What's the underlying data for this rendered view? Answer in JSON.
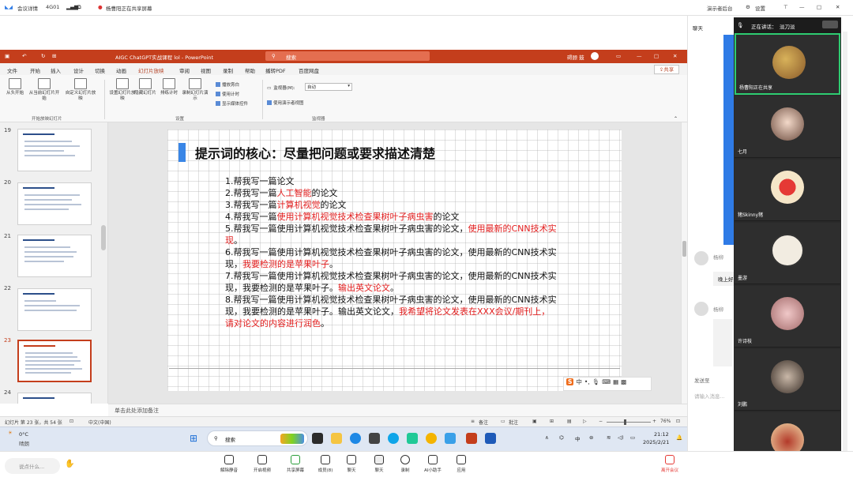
{
  "meeting": {
    "app_title": "会议详情",
    "network": "4G01",
    "meeting_name": "杨曹阳正在共享屏幕",
    "top_right": [
      "演示者后台",
      "设置"
    ],
    "speaker_label": "正在讲话：",
    "speaker_name": "淡刀淡"
  },
  "ppt": {
    "window_title": "AIGC ChatGPT实战课程 lol  -  PowerPoint",
    "search_placeholder": "搜索",
    "user": "碍顾 鼓",
    "tabs": [
      "文件",
      "开始",
      "插入",
      "设计",
      "切换",
      "动画",
      "幻灯片放映",
      "审阅",
      "视图",
      "录制",
      "帮助",
      "播转PDF",
      "百度网盘"
    ],
    "active_tab": "幻灯片放映",
    "share_label": "共享",
    "ribbon_buttons": [
      "从头开始",
      "从当前幻灯片开始",
      "自定义幻灯片放映",
      "设置幻灯片放映",
      "隐藏幻灯片",
      "排练计时",
      "录制幻灯片演示"
    ],
    "checks": [
      "播放旁白",
      "使用计时",
      "显示媒体控件"
    ],
    "monitor_label": "监视器(M):",
    "monitor_value": "自动",
    "presenter_view": "使用演示者视图",
    "groups": [
      "开始放映幻灯片",
      "设置",
      "监视器"
    ],
    "notes_placeholder": "单击此处添加备注",
    "status_left": "幻灯片 第 23 张，共 54 张",
    "status_lang": "中文(中国)",
    "status_notes": "备注",
    "status_comments": "批注",
    "zoom": "76%"
  },
  "slides": {
    "numbers": [
      "19",
      "20",
      "21",
      "22",
      "23",
      "24"
    ],
    "selected": "23"
  },
  "slide": {
    "title": "提示词的核心：尽量把问题或要求描述清楚",
    "items": [
      {
        "n": "1.帮我写一篇论文",
        "r": "",
        "t": ""
      },
      {
        "n": "2.帮我写一篇",
        "r": "人工智能",
        "t": "的论文"
      },
      {
        "n": "3.帮我写一篇",
        "r": "计算机视觉",
        "t": "的论文"
      },
      {
        "n": "4.帮我写一篇",
        "r": "使用计算机视觉技术检查果树叶子病虫害",
        "t": "的论文"
      },
      {
        "n": "5.帮我写一篇使用计算机视觉技术检查果树叶子病虫害的论文，",
        "r": "使用最新的CNN技术实现",
        "t": "。"
      },
      {
        "n": "6.帮我写一篇使用计算机视觉技术检查果树叶子病虫害的论文，使用最新的CNN技术实现，",
        "r": "我要检测的是苹果叶子",
        "t": "。"
      },
      {
        "n": "7.帮我写一篇使用计算机视觉技术检查果树叶子病虫害的论文，使用最新的CNN技术实现，我要检测的是苹果叶子。",
        "r": "输出英文论文",
        "t": "。"
      },
      {
        "n": "8.帮我写一篇使用计算机视觉技术检查果树叶子病虫害的论文，使用最新的CNN技术实现，我要检测的是苹果叶子。输出英文论文，",
        "r": "我希望将论文发表在XXX会议/期刊上，请对论文的内容进行润色",
        "t": "。"
      }
    ]
  },
  "ime": {
    "logo": "S",
    "label": "中"
  },
  "taskbar": {
    "weather_temp": "0°C",
    "weather_desc": "晴朗",
    "search_placeholder": "搜索",
    "time": "21:12",
    "date": "2025/2/21"
  },
  "chat": {
    "header": "聊天",
    "user1": "杨柳",
    "msg1": "晚上好",
    "user2": "杨柳",
    "send_to_label": "发送至",
    "input_placeholder": "请输入消息..."
  },
  "videos": [
    {
      "name": "杨曹阳正在共享"
    },
    {
      "name": "七月"
    },
    {
      "name": "猪Skinny猪"
    },
    {
      "name": "墨游"
    },
    {
      "name": "许诗枝"
    },
    {
      "name": "刘鹏"
    },
    {
      "name": ""
    }
  ],
  "bottom_bar": {
    "left_input": "说点什么...",
    "buttons": [
      "解除静音",
      "开启视频",
      "共享屏幕",
      "成员(8)",
      "聊天",
      "聊天",
      "录制",
      "AI小助手",
      "应用"
    ],
    "end_button": "离开会议"
  },
  "colors": {
    "ppt_red": "#c43e1c",
    "highlight_red": "#e21d1d",
    "title_bar_blue": "#3a86e6",
    "active_speaker": "#2ecc71"
  }
}
